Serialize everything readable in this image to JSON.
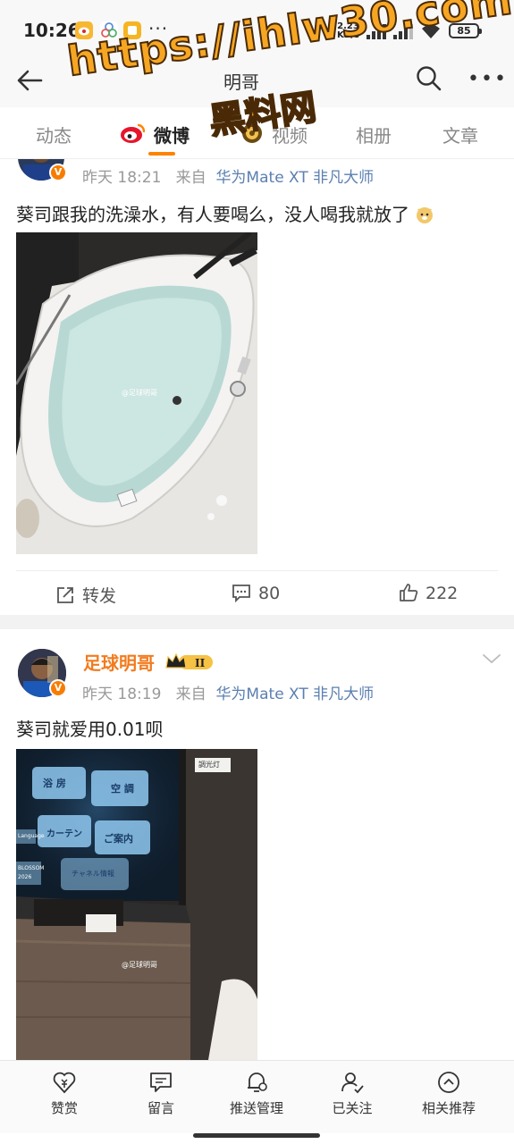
{
  "status_bar": {
    "time": "10:26",
    "net_speed": "2.23",
    "net_unit": "KB/s",
    "battery": "85",
    "more": "···"
  },
  "title_bar": {
    "title": "明哥"
  },
  "watermark": {
    "url": "https://ihlw30.com",
    "text": "黑料网"
  },
  "tabs": [
    {
      "label": "动态"
    },
    {
      "label": "微博",
      "active": true
    },
    {
      "label": "视频"
    },
    {
      "label": "相册"
    },
    {
      "label": "文章"
    }
  ],
  "posts": [
    {
      "time": "昨天 18:21",
      "from": "来自",
      "source": "华为Mate XT 非凡大师",
      "text": "葵司跟我的洗澡水，有人要喝么，没人喝我就放了",
      "image_watermark": "@足球明哥",
      "repost_label": "转发",
      "comments": "80",
      "likes": "222"
    },
    {
      "username": "足球明哥",
      "level": "II",
      "time": "昨天 18:19",
      "from": "来自",
      "source": "华为Mate XT 非凡大师",
      "text": "葵司就爱用0.01呗",
      "image_watermark": "@足球明哥",
      "panel_buttons": [
        "浴 房",
        "空 調",
        "カーテン",
        "ご案内",
        "チャネル情報"
      ],
      "panel_side_text": [
        "Language",
        "BLOSSOM",
        "2026"
      ],
      "panel_top_label": "調光灯"
    }
  ],
  "bottom_bar": [
    {
      "label": "赞赏",
      "icon": "reward-heart-icon"
    },
    {
      "label": "留言",
      "icon": "message-icon"
    },
    {
      "label": "推送管理",
      "icon": "bell-settings-icon"
    },
    {
      "label": "已关注",
      "icon": "followed-user-icon"
    },
    {
      "label": "相关推荐",
      "icon": "recommend-icon"
    }
  ],
  "colors": {
    "accent": "#ff8200",
    "username": "#f27b1e",
    "source_link": "#5b7fb0"
  }
}
